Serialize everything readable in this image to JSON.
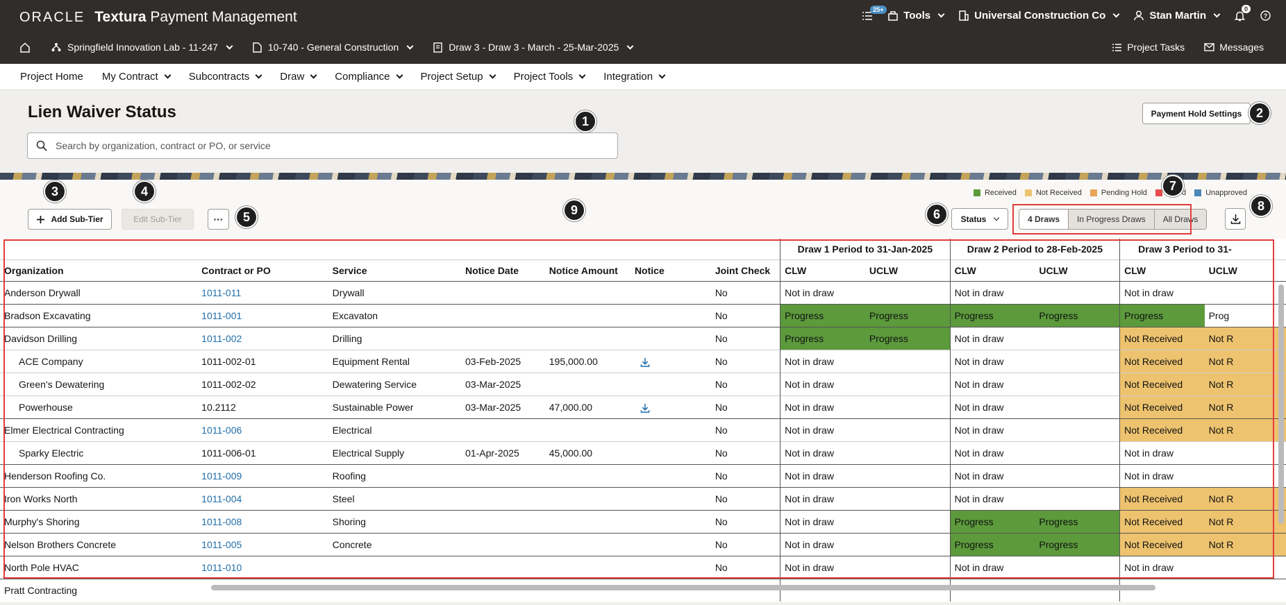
{
  "brand": {
    "oracle": "ORACLE",
    "product_bold": "Textura",
    "product_rest": " Payment Management"
  },
  "header": {
    "tasks_badge": "25+",
    "tools": "Tools",
    "company": "Universal Construction Co",
    "user": "Stan Martin",
    "notif_badge": "0",
    "crumbs": [
      "Springfield Innovation Lab - 11-247",
      "10-740 - General Construction",
      "Draw 3 - Draw 3 - March - 25-Mar-2025"
    ],
    "project_tasks": "Project Tasks",
    "messages": "Messages"
  },
  "nav": [
    "Project Home",
    "My Contract",
    "Subcontracts",
    "Draw",
    "Compliance",
    "Project Setup",
    "Project Tools",
    "Integration"
  ],
  "page": {
    "title": "Lien Waiver Status",
    "search_placeholder": "Search by organization, contract or PO, or service",
    "payment_hold_settings": "Payment Hold Settings",
    "add_sub_tier": "Add Sub-Tier",
    "edit_sub_tier": "Edit Sub-Tier",
    "more": "···",
    "status": "Status",
    "segments": [
      "4 Draws",
      "In Progress Draws",
      "All Draws"
    ]
  },
  "legend": [
    {
      "label": "Received",
      "color": "#5c9a3c"
    },
    {
      "label": "Not Received",
      "color": "#edc36f"
    },
    {
      "label": "Pending Hold",
      "color": "#e8a55a"
    },
    {
      "label": "d",
      "color": "#e84c4c"
    },
    {
      "label": "Unapproved",
      "color": "#4c86b5"
    }
  ],
  "callouts": [
    "1",
    "2",
    "3",
    "4",
    "5",
    "6",
    "7",
    "8",
    "9"
  ],
  "table": {
    "draw_headers": [
      "Draw 1 Period to 31-Jan-2025",
      "Draw 2 Period to 28-Feb-2025",
      "Draw 3 Period to 31-"
    ],
    "columns": [
      "Organization",
      "Contract or PO",
      "Service",
      "Notice Date",
      "Notice Amount",
      "Notice",
      "Joint Check",
      "CLW",
      "UCLW",
      "CLW",
      "UCLW",
      "CLW",
      "UCLW"
    ],
    "rows": [
      {
        "org": "Anderson Drywall",
        "po": "1011-011",
        "link": true,
        "svc": "Drywall",
        "date": "",
        "amt": "",
        "notice": false,
        "jc": "No",
        "d1": [
          "Not in draw",
          ""
        ],
        "d1span": true,
        "d2": [
          "Not in draw",
          ""
        ],
        "d2span": true,
        "d3": [
          "Not in draw",
          ""
        ],
        "d3span": true,
        "sub": false
      },
      {
        "org": "Bradson Excavating",
        "po": "1011-001",
        "link": true,
        "svc": "Excavaton",
        "date": "",
        "amt": "",
        "notice": false,
        "jc": "No",
        "d1": [
          "Progress",
          "Progress"
        ],
        "d2": [
          "Progress",
          "Progress"
        ],
        "d3": [
          "Progress",
          "Prog"
        ],
        "sub": false
      },
      {
        "org": "Davidson Drilling",
        "po": "1011-002",
        "link": true,
        "svc": "Drilling",
        "date": "",
        "amt": "",
        "notice": false,
        "jc": "No",
        "d1": [
          "Progress",
          "Progress"
        ],
        "d2": [
          "Not in draw",
          ""
        ],
        "d2span": true,
        "d3": [
          "Not Received",
          "Not R"
        ],
        "sub": false
      },
      {
        "org": "ACE Company",
        "po": "1011-002-01",
        "link": false,
        "svc": "Equipment Rental",
        "date": "03-Feb-2025",
        "amt": "195,000.00",
        "notice": true,
        "jc": "No",
        "d1": [
          "Not in draw",
          ""
        ],
        "d1span": true,
        "d2": [
          "Not in draw",
          ""
        ],
        "d2span": true,
        "d3": [
          "Not Received",
          "Not R"
        ],
        "sub": true
      },
      {
        "org": "Green's Dewatering",
        "po": "1011-002-02",
        "link": false,
        "svc": "Dewatering Service",
        "date": "03-Mar-2025",
        "amt": "",
        "notice": false,
        "jc": "No",
        "d1": [
          "Not in draw",
          ""
        ],
        "d1span": true,
        "d2": [
          "Not in draw",
          ""
        ],
        "d2span": true,
        "d3": [
          "Not Received",
          "Not R"
        ],
        "sub": true
      },
      {
        "org": "Powerhouse",
        "po": "10.2112",
        "link": false,
        "svc": "Sustainable Power",
        "date": "03-Mar-2025",
        "amt": "47,000.00",
        "notice": true,
        "jc": "No",
        "d1": [
          "Not in draw",
          ""
        ],
        "d1span": true,
        "d2": [
          "Not in draw",
          ""
        ],
        "d2span": true,
        "d3": [
          "Not Received",
          "Not R"
        ],
        "sub": true
      },
      {
        "org": "Elmer Electrical Contracting",
        "po": "1011-006",
        "link": true,
        "svc": "Electrical",
        "date": "",
        "amt": "",
        "notice": false,
        "jc": "No",
        "d1": [
          "Not in draw",
          ""
        ],
        "d1span": true,
        "d2": [
          "Not in draw",
          ""
        ],
        "d2span": true,
        "d3": [
          "Not Received",
          "Not R"
        ],
        "sub": false
      },
      {
        "org": "Sparky Electric",
        "po": "1011-006-01",
        "link": false,
        "svc": "Electrical Supply",
        "date": "01-Apr-2025",
        "amt": "45,000.00",
        "notice": false,
        "jc": "No",
        "d1": [
          "Not in draw",
          ""
        ],
        "d1span": true,
        "d2": [
          "Not in draw",
          ""
        ],
        "d2span": true,
        "d3": [
          "Not in draw",
          ""
        ],
        "d3span": true,
        "sub": true
      },
      {
        "org": "Henderson Roofing Co.",
        "po": "1011-009",
        "link": true,
        "svc": "Roofing",
        "date": "",
        "amt": "",
        "notice": false,
        "jc": "No",
        "d1": [
          "Not in draw",
          ""
        ],
        "d1span": true,
        "d2": [
          "Not in draw",
          ""
        ],
        "d2span": true,
        "d3": [
          "Not in draw",
          ""
        ],
        "d3span": true,
        "sub": false
      },
      {
        "org": "Iron Works North",
        "po": "1011-004",
        "link": true,
        "svc": "Steel",
        "date": "",
        "amt": "",
        "notice": false,
        "jc": "No",
        "d1": [
          "Not in draw",
          ""
        ],
        "d1span": true,
        "d2": [
          "Not in draw",
          ""
        ],
        "d2span": true,
        "d3": [
          "Not Received",
          "Not R"
        ],
        "sub": false
      },
      {
        "org": "Murphy's Shoring",
        "po": "1011-008",
        "link": true,
        "svc": "Shoring",
        "date": "",
        "amt": "",
        "notice": false,
        "jc": "No",
        "d1": [
          "Not in draw",
          ""
        ],
        "d1span": true,
        "d2": [
          "Progress",
          "Progress"
        ],
        "d3": [
          "Not Received",
          "Not R"
        ],
        "sub": false
      },
      {
        "org": "Nelson Brothers Concrete",
        "po": "1011-005",
        "link": true,
        "svc": "Concrete",
        "date": "",
        "amt": "",
        "notice": false,
        "jc": "No",
        "d1": [
          "Not in draw",
          ""
        ],
        "d1span": true,
        "d2": [
          "Progress",
          "Progress"
        ],
        "d3": [
          "Not Received",
          "Not R"
        ],
        "sub": false
      },
      {
        "org": "North Pole HVAC",
        "po": "1011-010",
        "link": true,
        "svc": "",
        "date": "",
        "amt": "",
        "notice": false,
        "jc": "No",
        "d1": [
          "Not in draw",
          ""
        ],
        "d1span": true,
        "d2": [
          "Not in draw",
          ""
        ],
        "d2span": true,
        "d3": [
          "Not in draw",
          ""
        ],
        "d3span": true,
        "sub": false
      },
      {
        "org": "Pratt Contracting",
        "po": "",
        "link": false,
        "svc": "",
        "date": "",
        "amt": "",
        "notice": false,
        "jc": "",
        "d1": [
          "",
          ""
        ],
        "d2": [
          "",
          ""
        ],
        "d3": [
          "",
          ""
        ],
        "sub": false
      }
    ]
  }
}
